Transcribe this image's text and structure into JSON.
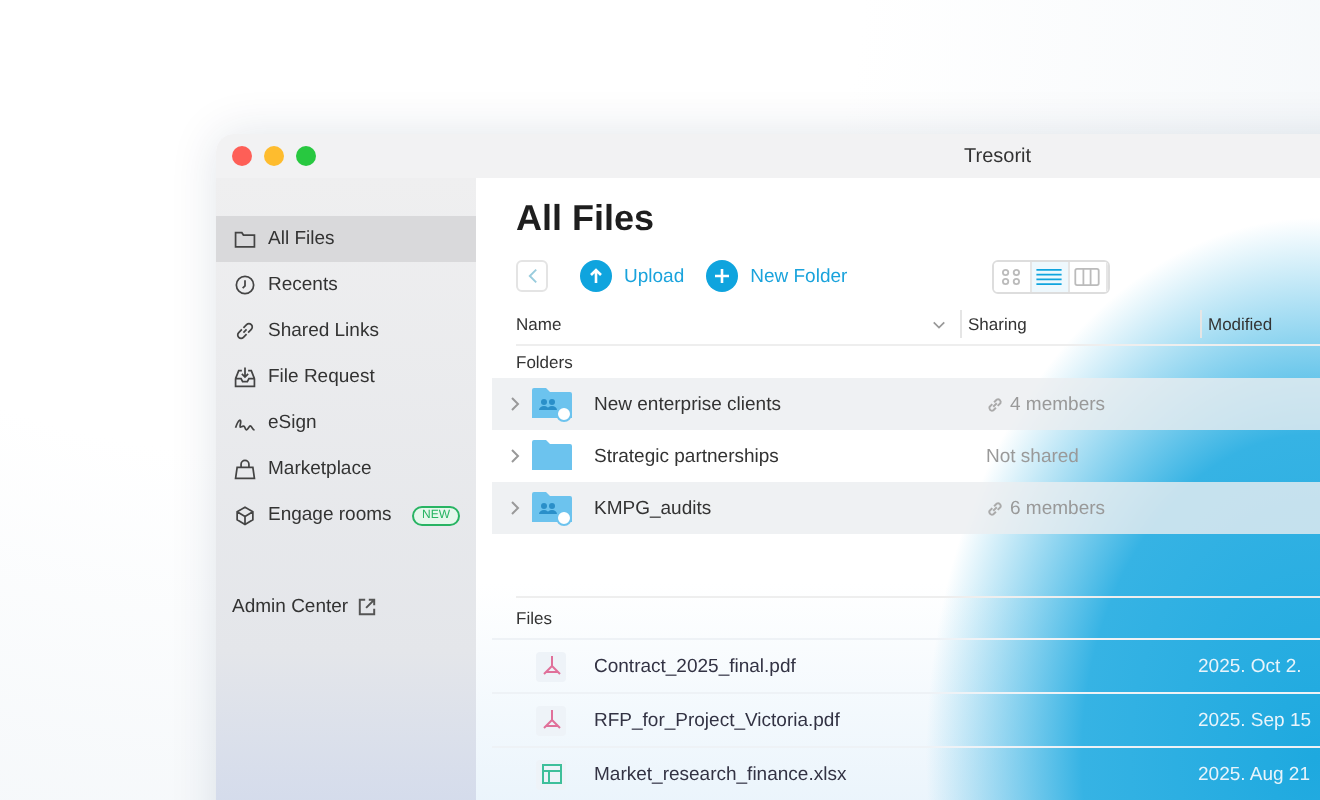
{
  "window": {
    "title": "Tresorit"
  },
  "sidebar": {
    "items": [
      {
        "label": "All Files",
        "selected": true
      },
      {
        "label": "Recents",
        "selected": false
      },
      {
        "label": "Shared Links",
        "selected": false
      },
      {
        "label": "File Request",
        "selected": false
      },
      {
        "label": "eSign",
        "selected": false
      },
      {
        "label": "Marketplace",
        "selected": false
      },
      {
        "label": "Engage rooms",
        "selected": false,
        "badge": "NEW"
      }
    ],
    "footer_link": "Admin Center"
  },
  "page_title": "All Files",
  "toolbar": {
    "actions": [
      {
        "label": "Upload"
      },
      {
        "label": "New Folder"
      }
    ],
    "views": [
      {
        "kind": "grid",
        "selected": false
      },
      {
        "kind": "list",
        "selected": true
      },
      {
        "kind": "columns",
        "selected": false
      }
    ]
  },
  "table": {
    "columns": [
      "Name",
      "Sharing",
      "Modified"
    ],
    "folders_label": "Folders",
    "folders": [
      {
        "name": "New enterprise clients",
        "shared": true,
        "sharing": "4 members"
      },
      {
        "name": "Strategic partnerships",
        "shared": false,
        "sharing": "Not shared"
      },
      {
        "name": "KMPG_audits",
        "shared": true,
        "sharing": "6 members"
      }
    ],
    "files_label": "Files",
    "files": [
      {
        "name": "Contract_2025_final.pdf",
        "kind": "pdf",
        "modified": "2025. Oct 2."
      },
      {
        "name": "RFP_for_Project_Victoria.pdf",
        "kind": "pdf",
        "modified": "2025. Sep 15"
      },
      {
        "name": "Market_research_finance.xlsx",
        "kind": "xlsx",
        "modified": "2025. Aug 21"
      }
    ]
  }
}
